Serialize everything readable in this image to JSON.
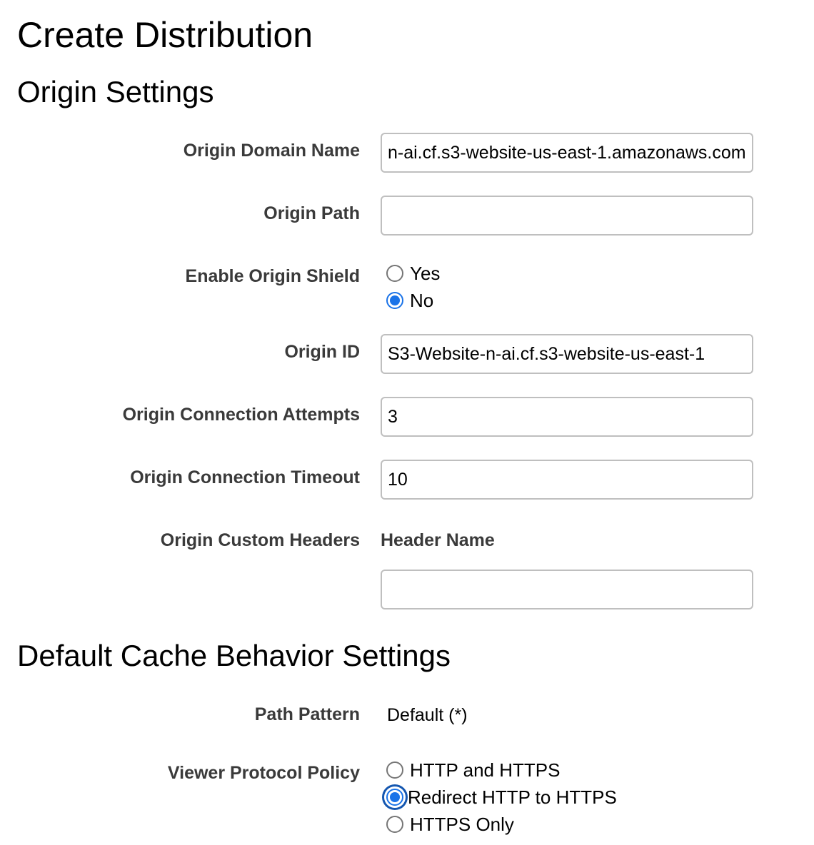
{
  "page": {
    "title": "Create Distribution"
  },
  "origin_settings": {
    "section_title": "Origin Settings",
    "origin_domain_name": {
      "label": "Origin Domain Name",
      "value": "n-ai.cf.s3-website-us-east-1.amazonaws.com"
    },
    "origin_path": {
      "label": "Origin Path",
      "value": ""
    },
    "enable_origin_shield": {
      "label": "Enable Origin Shield",
      "options": [
        {
          "label": "Yes",
          "checked": false
        },
        {
          "label": "No",
          "checked": true
        }
      ]
    },
    "origin_id": {
      "label": "Origin ID",
      "value": "S3-Website-n-ai.cf.s3-website-us-east-1"
    },
    "origin_connection_attempts": {
      "label": "Origin Connection Attempts",
      "value": "3"
    },
    "origin_connection_timeout": {
      "label": "Origin Connection Timeout",
      "value": "10"
    },
    "origin_custom_headers": {
      "label": "Origin Custom Headers",
      "header_name_label": "Header Name",
      "header_name_value": ""
    }
  },
  "default_cache_behavior": {
    "section_title": "Default Cache Behavior Settings",
    "path_pattern": {
      "label": "Path Pattern",
      "value": "Default (*)"
    },
    "viewer_protocol_policy": {
      "label": "Viewer Protocol Policy",
      "options": [
        {
          "label": "HTTP and HTTPS",
          "checked": false
        },
        {
          "label": "Redirect HTTP to HTTPS",
          "checked": true
        },
        {
          "label": "HTTPS Only",
          "checked": false
        }
      ]
    }
  },
  "colors": {
    "accent": "#1a73e8",
    "label_text": "#3a3a3a",
    "input_border": "#bfbfbf"
  }
}
